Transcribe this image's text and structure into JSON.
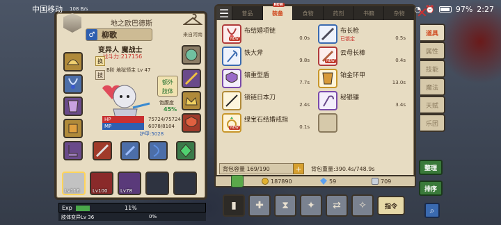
{
  "status_bar": {
    "carrier": "中国移动",
    "network": "108 B/s",
    "battery": "97%",
    "time": "2:27"
  },
  "character": {
    "header": "地之欧巴德斯",
    "location": "来自河南",
    "name": "柳歌",
    "gender_symbol": "♂",
    "job": "变异人 魔战士",
    "power": "战斗力:217156",
    "level_line": "B阶 地狱领主 Lv 47",
    "swap_label": "换",
    "skill_label": "技",
    "extra_body": [
      "额外",
      "肢体"
    ],
    "satiety_label": "饱腹度",
    "satiety_value": "45%",
    "hp_label": "HP",
    "hp_value": "75724/75724",
    "mp_label": "MP",
    "mp_value": "6078/8104",
    "armor": "护甲:5028",
    "pets": [
      {
        "level": "Lv116"
      },
      {
        "level": "Lv100"
      },
      {
        "level": "Lv78"
      },
      {
        "level": ""
      },
      {
        "level": ""
      }
    ],
    "exp_label": "Exp",
    "exp_percent": "11%",
    "exp_fraction": 0.11,
    "sub_label": "肢体变异Lv 36",
    "sub_percent": "0%"
  },
  "inventory": {
    "tabs": [
      {
        "label": "普品",
        "active": false,
        "new": false
      },
      {
        "label": "装备",
        "active": true,
        "new": true
      },
      {
        "label": "食物",
        "active": false,
        "new": false
      },
      {
        "label": "药剂",
        "active": false,
        "new": false
      },
      {
        "label": "书籍",
        "active": false,
        "new": false
      },
      {
        "label": "杂物",
        "active": false,
        "new": false
      }
    ],
    "new_label": "NEW",
    "items": [
      {
        "name": "布结婚项链",
        "weight": "0.0s",
        "tag": "NEW",
        "locked": ""
      },
      {
        "name": "布长枪",
        "weight": "0.5s",
        "tag": "",
        "locked": "已锁定"
      },
      {
        "name": "铁大斧",
        "weight": "9.8s",
        "tag": "",
        "locked": ""
      },
      {
        "name": "云母长棒",
        "weight": "0.4s",
        "tag": "NEW",
        "locked": ""
      },
      {
        "name": "铬重型盾",
        "weight": "7.7s",
        "tag": "",
        "locked": ""
      },
      {
        "name": "铂金环甲",
        "weight": "13.0s",
        "tag": "",
        "locked": ""
      },
      {
        "name": "锁链日本刀",
        "weight": "2.4s",
        "tag": "",
        "locked": ""
      },
      {
        "name": "秘银镰",
        "weight": "3.4s",
        "tag": "",
        "locked": ""
      },
      {
        "name": "绿宝石结婚戒指",
        "weight": "0.1s",
        "tag": "NEW",
        "locked": ""
      },
      {
        "name": "",
        "weight": "",
        "tag": "",
        "locked": ""
      }
    ],
    "capacity": "背包容量 169/190",
    "weight": "背包重量:390.4s/748.9s",
    "gold": "187890",
    "gems": "59",
    "crystals": "709"
  },
  "side_tabs": [
    "道具",
    "属性",
    "技能",
    "魔法",
    "天赋",
    "乐团"
  ],
  "buttons": {
    "sort": "整理",
    "order": "排序",
    "command": "指令",
    "plus": "+"
  },
  "colors": {
    "parchment": "#e7dcc2",
    "frame": "#3b3328",
    "accent": "#d04a20",
    "hp": "#c83030",
    "mp": "#2e5fb0"
  }
}
